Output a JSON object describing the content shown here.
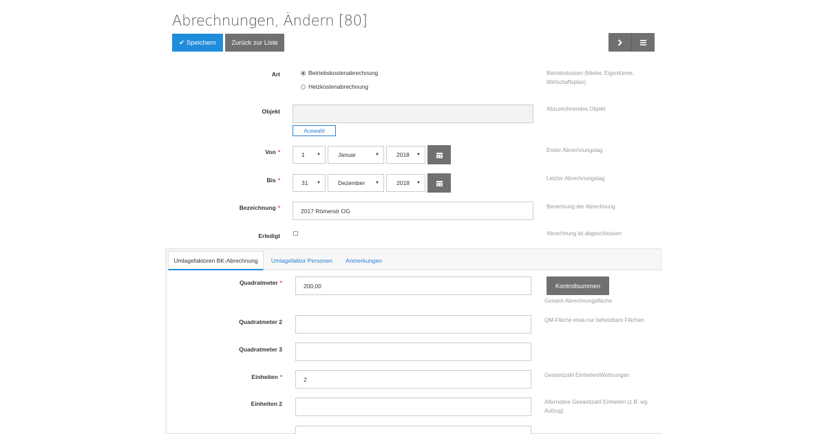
{
  "page": {
    "title": "Abrechnungen, Ändern [80]"
  },
  "toolbar": {
    "save_label": "✔ Speichern",
    "back_label": "Zurück zur Liste",
    "next_icon": "chevron-right-icon",
    "menu_icon": "menu-icon"
  },
  "form": {
    "art": {
      "label": "Art",
      "options": [
        "Betriebskostenabrechnung",
        "Heizkostenabrechnung"
      ],
      "selected": "Betriebskostenabrechnung",
      "help": "Betriebskosten (Mieter, Eigentümer, Wirtschaftsplan)"
    },
    "objekt": {
      "label": "Objekt",
      "value": "",
      "button": "Auswahl",
      "help": "Abzurechnendes Objekt"
    },
    "von": {
      "label": "Von",
      "day": "1",
      "month": "Januar",
      "year": "2018",
      "help": "Erster Abrechnungstag"
    },
    "bis": {
      "label": "Bis",
      "day": "31",
      "month": "Dezember",
      "year": "2018",
      "help": "Letzter Abrechnungstag"
    },
    "bezeichnung": {
      "label": "Bezeichnung",
      "value": "2017 Römerstr OG",
      "help": "Benennung der Abrechnung"
    },
    "erledigt": {
      "label": "Erledigt",
      "checked": false,
      "help": "Abrechnung ist abgeschlossen"
    },
    "required_mark": "*"
  },
  "tabs": [
    {
      "label": "Umlagefaktoren BK-Abrechnung",
      "active": true
    },
    {
      "label": "Umlagefaktor Personen",
      "active": false
    },
    {
      "label": "Anmerkungen",
      "active": false
    }
  ],
  "umlage": {
    "quadratmeter": {
      "label": "Quadratmeter",
      "value": "200,00",
      "button": "Kontrollsummen",
      "help": "Gesamt Abrechnungsfläche"
    },
    "quadratmeter2": {
      "label": "Quadratmeter 2",
      "value": "",
      "help": "QM-Fläche etwa nur beheizbare Flächen"
    },
    "quadratmeter3": {
      "label": "Quadratmeter 3",
      "value": "",
      "help": ""
    },
    "einheiten": {
      "label": "Einheiten",
      "value": "2",
      "help": "Gesamtzahl Einheiten/Wohnungen"
    },
    "einheiten2": {
      "label": "Einheiten 2",
      "value": "",
      "help": "Alternative Gesamtzahl Einheiten (z.B. wg. Aufzug)"
    }
  },
  "colors": {
    "primary": "#1f8ddb",
    "secondary": "#707070",
    "required": "#d9534f",
    "link": "#2a7ed2"
  }
}
